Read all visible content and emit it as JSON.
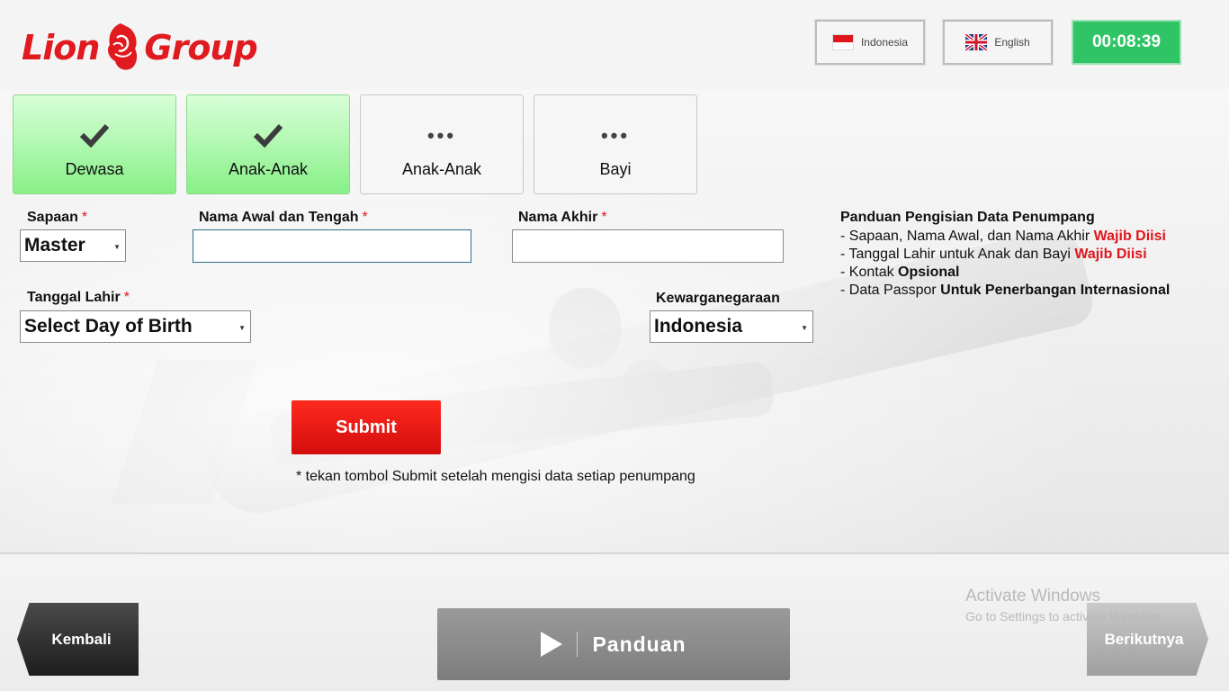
{
  "brand": {
    "part1": "Lion",
    "part2": "Group",
    "color": "#e01a1f"
  },
  "languages": [
    {
      "label": "Indonesia",
      "flag": "flag-indonesia-icon"
    },
    {
      "label": "English",
      "flag": "flag-uk-icon"
    }
  ],
  "timer": "00:08:39",
  "passenger_tabs": [
    {
      "label": "Dewasa",
      "status": "done",
      "icon": "checkmark-icon"
    },
    {
      "label": "Anak-Anak",
      "status": "done",
      "icon": "checkmark-icon"
    },
    {
      "label": "Anak-Anak",
      "status": "pending",
      "icon": "ellipsis-icon",
      "dots": "•••"
    },
    {
      "label": "Bayi",
      "status": "pending",
      "icon": "ellipsis-icon",
      "dots": "•••"
    }
  ],
  "form": {
    "salutation": {
      "label": "Sapaan",
      "required_mark": "*",
      "value": "Master"
    },
    "first_name": {
      "label": "Nama Awal dan Tengah",
      "required_mark": "*",
      "value": ""
    },
    "last_name": {
      "label": "Nama Akhir",
      "required_mark": "*",
      "value": ""
    },
    "birth_date": {
      "label": "Tanggal Lahir",
      "required_mark": "*",
      "value": "Select Day of Birth"
    },
    "nationality": {
      "label": "Kewarganegaraan",
      "value": "Indonesia"
    }
  },
  "guide": {
    "title": "Panduan Pengisian Data Penumpang",
    "lines": [
      {
        "text": "- Sapaan, Nama Awal, dan Nama Akhir ",
        "emph": "Wajib Diisi"
      },
      {
        "text": "- Tanggal Lahir untuk Anak dan Bayi ",
        "emph": "Wajib Diisi"
      },
      {
        "text": "- Kontak ",
        "emph": "Opsional"
      },
      {
        "text": "- Data Passpor ",
        "emph": "Untuk Penerbangan Internasional"
      }
    ]
  },
  "submit_label": "Submit",
  "submit_note": "* tekan tombol Submit setelah mengisi data setiap penumpang",
  "nav": {
    "back": "Kembali",
    "guide": "Panduan",
    "next": "Berikutnya"
  },
  "watermark": {
    "line1": "Activate Windows",
    "line2": "Go to Settings to activate Windows."
  },
  "colors": {
    "accent_red": "#e0161b",
    "timer_green": "#2fc466",
    "done_green": "#88f088"
  }
}
